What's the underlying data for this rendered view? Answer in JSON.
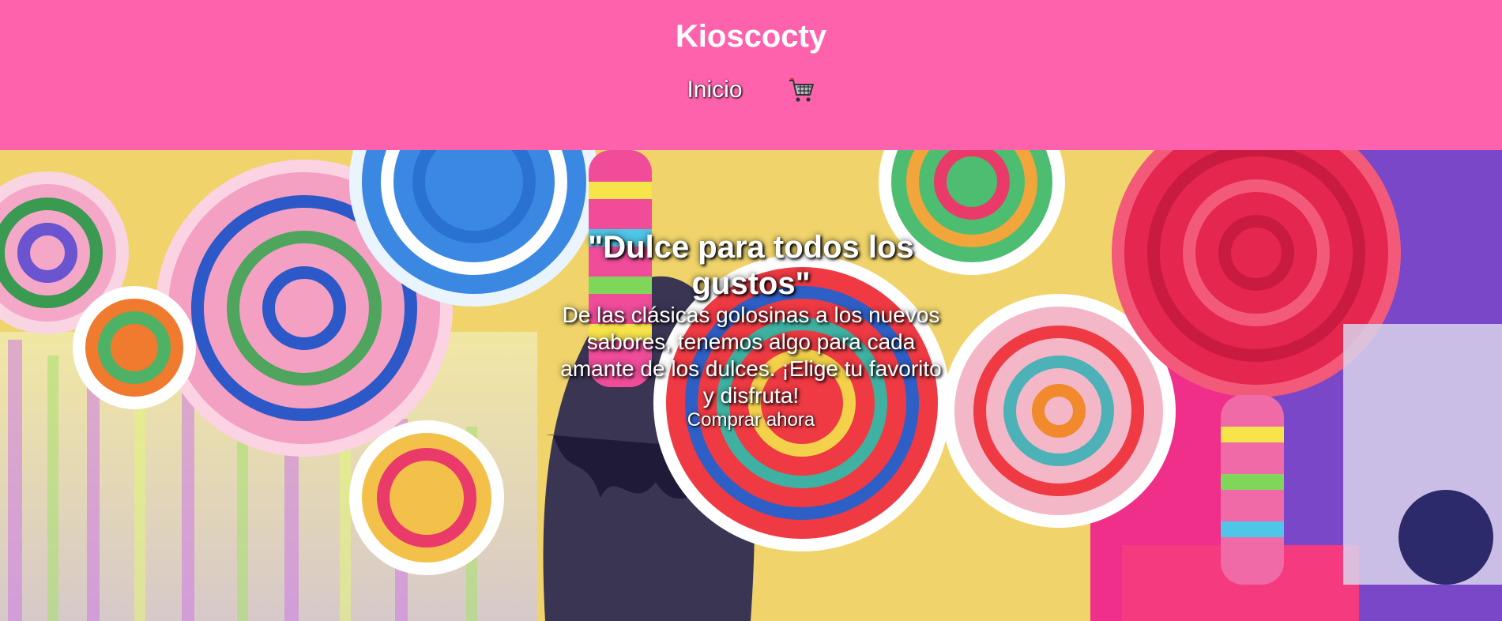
{
  "header": {
    "brand": "Kioscocty",
    "nav": {
      "home_label": "Inicio",
      "cart_icon": "shopping-cart-icon"
    }
  },
  "hero": {
    "title": "\"Dulce para todos los gustos\"",
    "text": "De las clásicas golosinas a los nuevos sabores, tenemos algo para cada amante de los dulces. ¡Elige tu favorito y disfruta!",
    "cta_label": "Comprar ahora",
    "background_image": "colorful-lollipops-candy-store"
  },
  "colors": {
    "header_bg": "#ff62ad",
    "text": "#ffffff"
  }
}
